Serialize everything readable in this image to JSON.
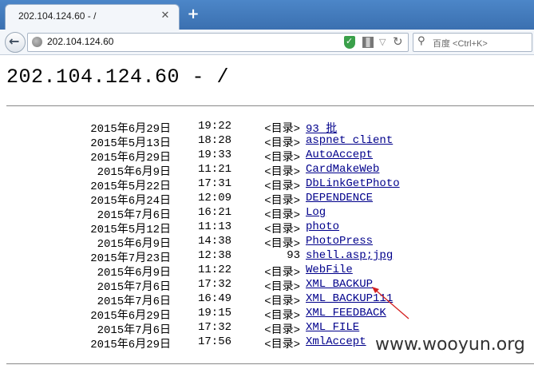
{
  "tab": {
    "title": "202.104.124.60 - /",
    "close_icon": "close-icon",
    "new_tab_icon": "plus-icon"
  },
  "nav": {
    "url": "202.104.124.60",
    "search_placeholder": "百度 <Ctrl+K>",
    "icons": [
      "back-arrow-icon",
      "globe-icon",
      "shield-icon",
      "qr-code-icon",
      "dropdown-icon",
      "reload-icon",
      "search-icon"
    ]
  },
  "page": {
    "title": "202.104.124.60 - /",
    "entries": [
      {
        "date": "2015年6月29日",
        "time": "19:22",
        "kind": "<目录>",
        "name": "93 批"
      },
      {
        "date": "2015年5月13日",
        "time": "18:28",
        "kind": "<目录>",
        "name": "aspnet_client"
      },
      {
        "date": "2015年6月29日",
        "time": "19:33",
        "kind": "<目录>",
        "name": "AutoAccept"
      },
      {
        "date": "2015年6月9日",
        "time": "11:21",
        "kind": "<目录>",
        "name": "CardMakeWeb"
      },
      {
        "date": "2015年5月22日",
        "time": "17:31",
        "kind": "<目录>",
        "name": "DbLinkGetPhoto"
      },
      {
        "date": "2015年6月24日",
        "time": "12:09",
        "kind": "<目录>",
        "name": "DEPENDENCE"
      },
      {
        "date": "2015年7月6日",
        "time": "16:21",
        "kind": "<目录>",
        "name": "Log"
      },
      {
        "date": "2015年5月12日",
        "time": "11:13",
        "kind": "<目录>",
        "name": "photo"
      },
      {
        "date": "2015年6月9日",
        "time": "14:38",
        "kind": "<目录>",
        "name": "PhotoPress"
      },
      {
        "date": "2015年7月23日",
        "time": "12:38",
        "kind": "93",
        "name": "shell.asp;jpg"
      },
      {
        "date": "2015年6月9日",
        "time": "11:22",
        "kind": "<目录>",
        "name": "WebFile"
      },
      {
        "date": "2015年7月6日",
        "time": "17:32",
        "kind": "<目录>",
        "name": "XML_BACKUP"
      },
      {
        "date": "2015年7月6日",
        "time": "16:49",
        "kind": "<目录>",
        "name": "XML_BACKUP111"
      },
      {
        "date": "2015年6月29日",
        "time": "19:15",
        "kind": "<目录>",
        "name": "XML_FEEDBACK"
      },
      {
        "date": "2015年7月6日",
        "time": "17:32",
        "kind": "<目录>",
        "name": "XML_FILE"
      },
      {
        "date": "2015年6月29日",
        "time": "17:56",
        "kind": "<目录>",
        "name": "XmlAccept"
      }
    ]
  },
  "annotation": {
    "arrow_color": "#d42020"
  },
  "watermark": "www.wooyun.org"
}
